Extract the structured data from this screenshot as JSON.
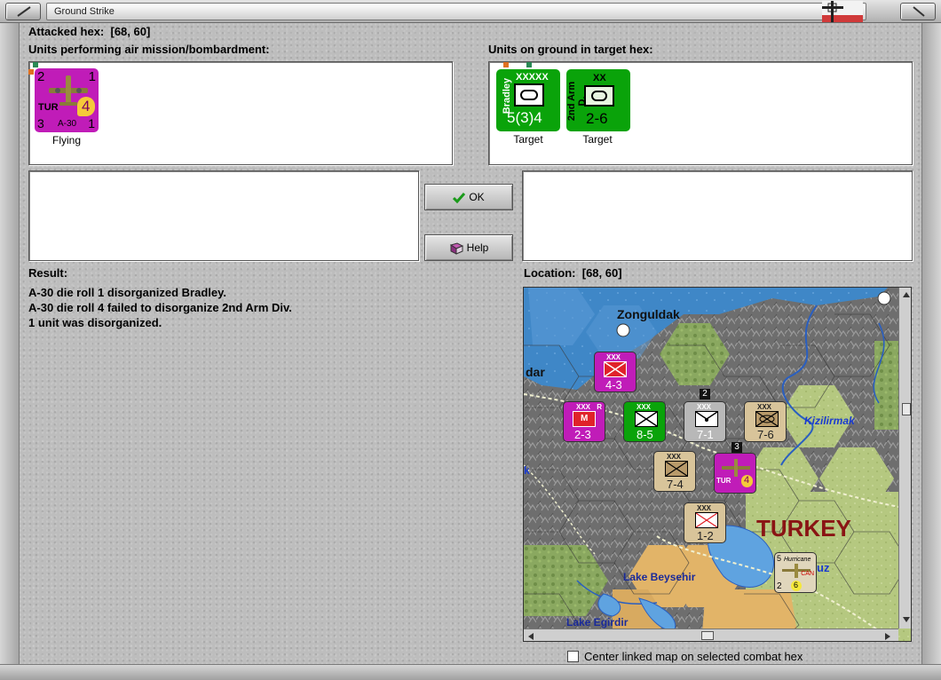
{
  "window": {
    "title": "Ground Strike"
  },
  "attacked_hex": {
    "label": "Attacked hex:",
    "value": "[68, 60]"
  },
  "air_units": {
    "label": "Units performing air mission/bombardment:",
    "items": [
      {
        "top_left": "2",
        "top_right": "1",
        "nation": "TUR",
        "factor": "4",
        "bottom_left": "3",
        "type": "A-30",
        "bottom_right": "1",
        "status": "Flying"
      }
    ]
  },
  "ground_units": {
    "label": "Units on ground in target hex:",
    "items": [
      {
        "name": "Bradley",
        "size": "XXXXX",
        "strength": "5(3)4",
        "status": "Target"
      },
      {
        "name": "2nd Arm D.",
        "size": "XX",
        "strength": "2-6",
        "status": "Target"
      }
    ]
  },
  "buttons": {
    "ok": "OK",
    "help": "Help"
  },
  "result": {
    "label": "Result:",
    "lines": [
      "A-30 die roll 1 disorganized Bradley.",
      "A-30 die roll 4 failed to disorganize 2nd Arm Div.",
      "1 unit was disorganized."
    ]
  },
  "location": {
    "label": "Location:",
    "value": "[68, 60]"
  },
  "map": {
    "place_names": {
      "zonguldak": "Zonguldak",
      "dar": "dar",
      "kizilirmak": "Kizilirmak",
      "turkey": "TURKEY",
      "uz": "uz",
      "lake_beysehir": "Lake Beysehir",
      "lake_egirdir": "Lake Egirdir",
      "k": "k"
    },
    "counters": [
      {
        "id": "c1",
        "size": "XXX",
        "strength": "4-3"
      },
      {
        "id": "c2",
        "size": "XXX",
        "strength": "2-3",
        "corner": "R"
      },
      {
        "id": "c3",
        "size": "XXX",
        "strength": "8-5"
      },
      {
        "id": "c4",
        "size": "XXX",
        "strength": "7-1",
        "stack": "2"
      },
      {
        "id": "c5",
        "size": "XXX",
        "strength": "7-6"
      },
      {
        "id": "c6",
        "size": "XXX",
        "strength": "7-4"
      },
      {
        "id": "c7",
        "size": "XXX",
        "strength": "1-2"
      },
      {
        "id": "c8",
        "nation": "TUR",
        "factor": "4",
        "stack": "3"
      },
      {
        "id": "c9",
        "name": "Hurricane",
        "top_left": "5",
        "nation": "CAN",
        "bottom_left": "2",
        "factor": "6"
      }
    ]
  },
  "center_map": {
    "label": "Center linked map on selected combat hex",
    "checked": false
  },
  "colors": {
    "ground_unit": "#0aa30a",
    "air_unit": "#c01cb8",
    "panel_bg": "#ffffff"
  }
}
